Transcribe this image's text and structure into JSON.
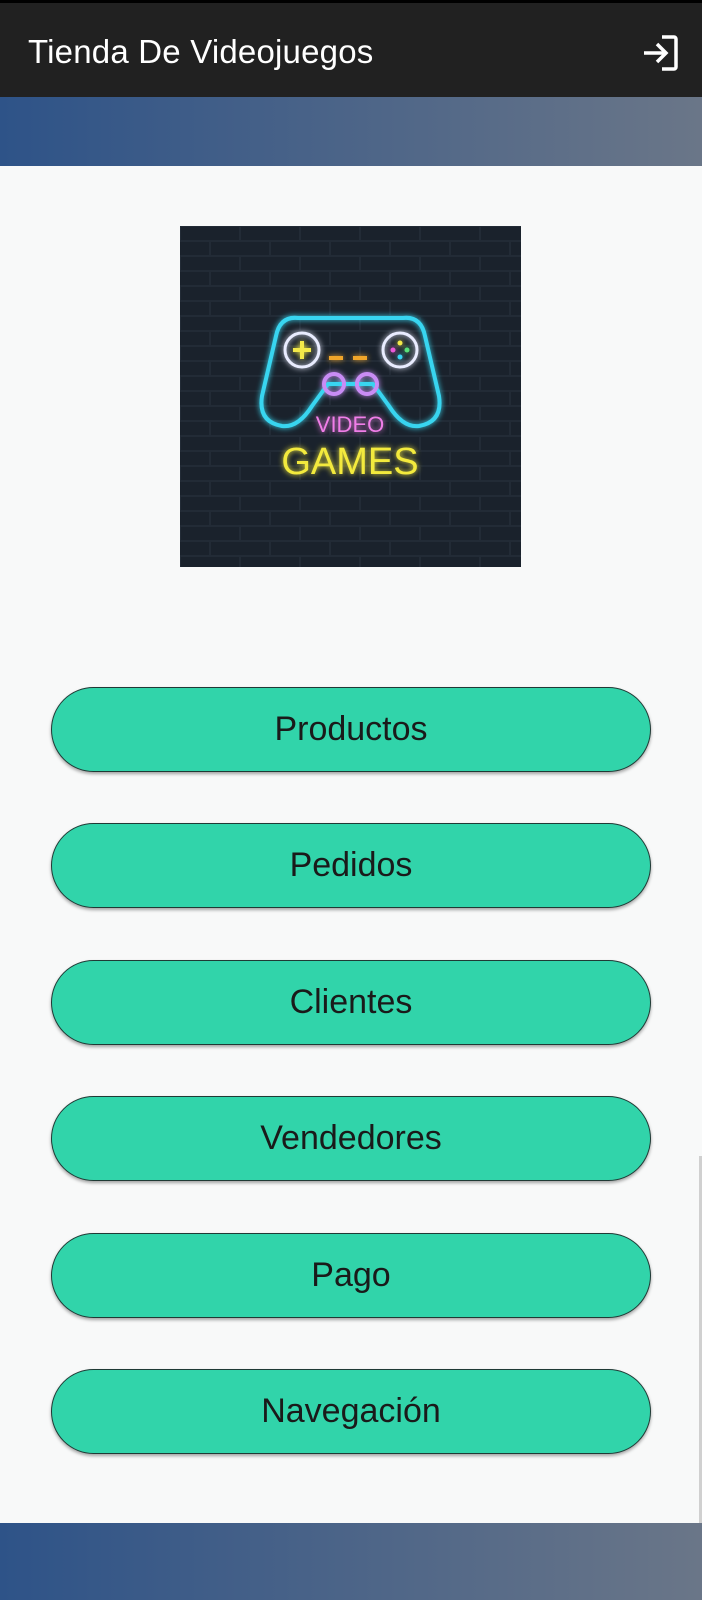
{
  "appbar": {
    "title": "Tienda De Videojuegos",
    "login_icon": "login-icon"
  },
  "logo": {
    "word_top": "VIDEO",
    "word_bottom": "GAMES"
  },
  "menu": {
    "items": [
      {
        "label": "Productos"
      },
      {
        "label": "Pedidos"
      },
      {
        "label": "Clientes"
      },
      {
        "label": "Vendedores"
      },
      {
        "label": "Pago"
      },
      {
        "label": "Navegación"
      }
    ]
  },
  "colors": {
    "appbar": "#212121",
    "button": "#31d4aa",
    "gradient_start": "#2e5388",
    "gradient_end": "#6a7688",
    "background": "#f8f9f9"
  }
}
